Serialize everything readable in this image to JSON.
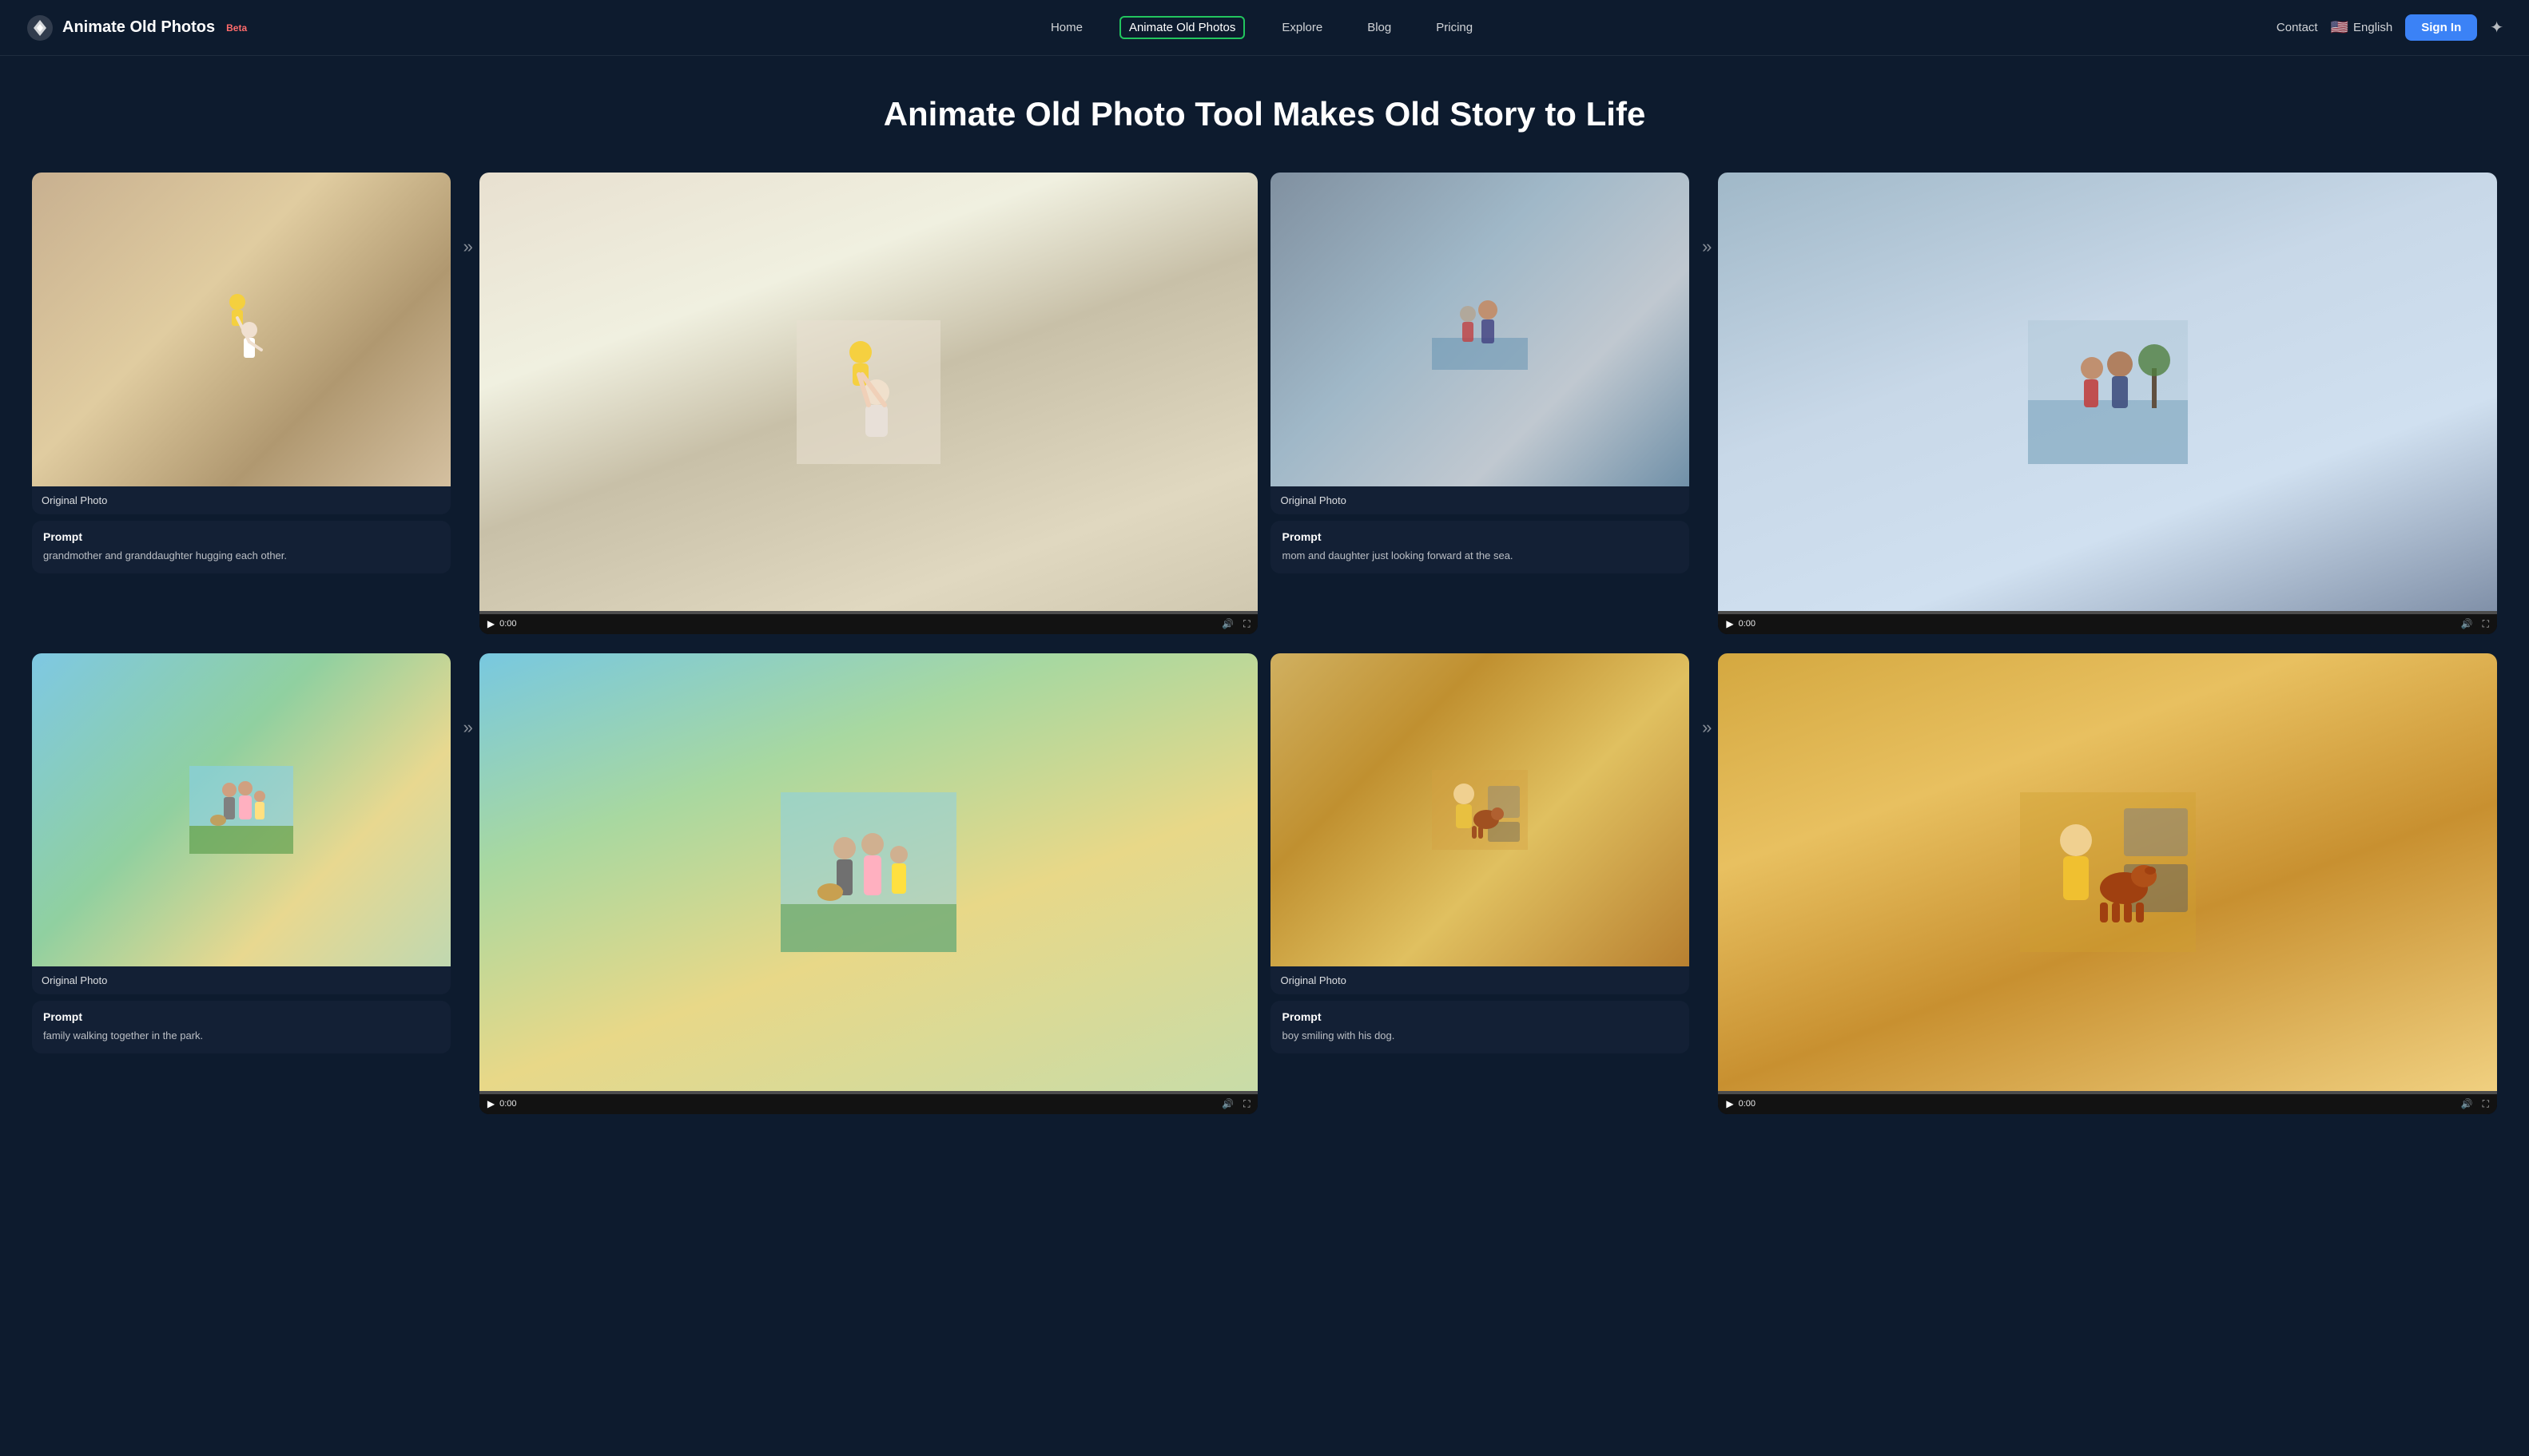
{
  "site": {
    "logo_text": "Animate Old Photos",
    "beta_label": "Beta"
  },
  "navbar": {
    "links": [
      {
        "id": "home",
        "label": "Home",
        "active": false
      },
      {
        "id": "animate",
        "label": "Animate Old Photos",
        "active": true
      },
      {
        "id": "explore",
        "label": "Explore",
        "active": false
      },
      {
        "id": "blog",
        "label": "Blog",
        "active": false
      },
      {
        "id": "pricing",
        "label": "Pricing",
        "active": false
      }
    ],
    "contact_label": "Contact",
    "lang_label": "English",
    "sign_in_label": "Sign In"
  },
  "hero": {
    "title": "Animate Old Photo Tool Makes Old Story to Life"
  },
  "gallery": {
    "rows": [
      {
        "pairs": [
          {
            "photo_label": "Original Photo",
            "prompt_title": "Prompt",
            "prompt_text": "grandmother and granddaughter hugging each other.",
            "video_time": "0:00"
          },
          {
            "photo_label": "Original Photo",
            "prompt_title": "Prompt",
            "prompt_text": "mom and daughter just looking forward at the sea.",
            "video_time": "0:00"
          }
        ]
      },
      {
        "pairs": [
          {
            "photo_label": "Original Photo",
            "prompt_title": "Prompt",
            "prompt_text": "family walking together in the park.",
            "video_time": "0:00"
          },
          {
            "photo_label": "Original Photo",
            "prompt_title": "Prompt",
            "prompt_text": "boy smiling with his dog.",
            "video_time": "0:00"
          }
        ]
      }
    ]
  }
}
